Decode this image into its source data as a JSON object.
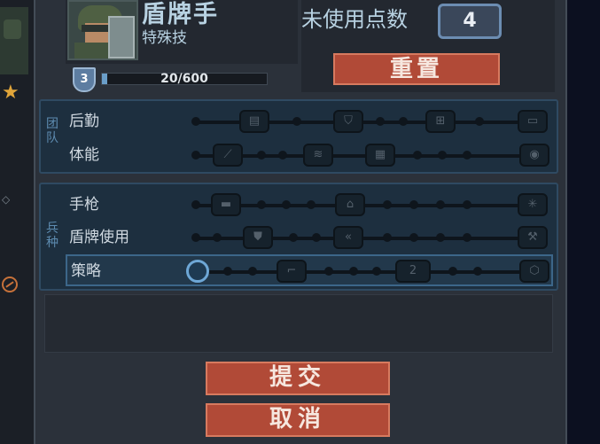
{
  "soldier": {
    "class_name": "盾牌手",
    "subtitle": "特殊技",
    "rank": "3",
    "xp_text": "20/600",
    "xp_progress": 0.033
  },
  "points": {
    "label": "未使用点数",
    "value": "4"
  },
  "buttons": {
    "reset": "重置",
    "submit": "提交",
    "cancel": "取消"
  },
  "groups": [
    {
      "label": "团队",
      "rows": [
        {
          "label": "后勤",
          "nodes": [
            "ammo-icon",
            "shield-plus-icon",
            "medkit-icon",
            "supply-icon"
          ]
        },
        {
          "label": "体能",
          "nodes": [
            "knife-icon",
            "sprint-icon",
            "armor-icon",
            "grenade-icon"
          ]
        }
      ]
    },
    {
      "label": "兵种",
      "rows": [
        {
          "label": "手枪",
          "nodes": [
            "pistol-icon",
            "cover-icon",
            "crossfire-icon"
          ]
        },
        {
          "label": "盾牌使用",
          "nodes": [
            "shield-icon",
            "rank-chevron-icon",
            "wrench-icon"
          ]
        },
        {
          "label": "策略",
          "nodes": [
            "ring-icon",
            "gun-icon",
            "double-icon",
            "badge-icon"
          ],
          "node_texts": [
            "",
            "",
            "2",
            ""
          ]
        }
      ]
    }
  ],
  "colors": {
    "accent": "#b14a37",
    "panel": "#2b313a",
    "group": "#1d2f3f",
    "text": "#b8d2e2"
  }
}
